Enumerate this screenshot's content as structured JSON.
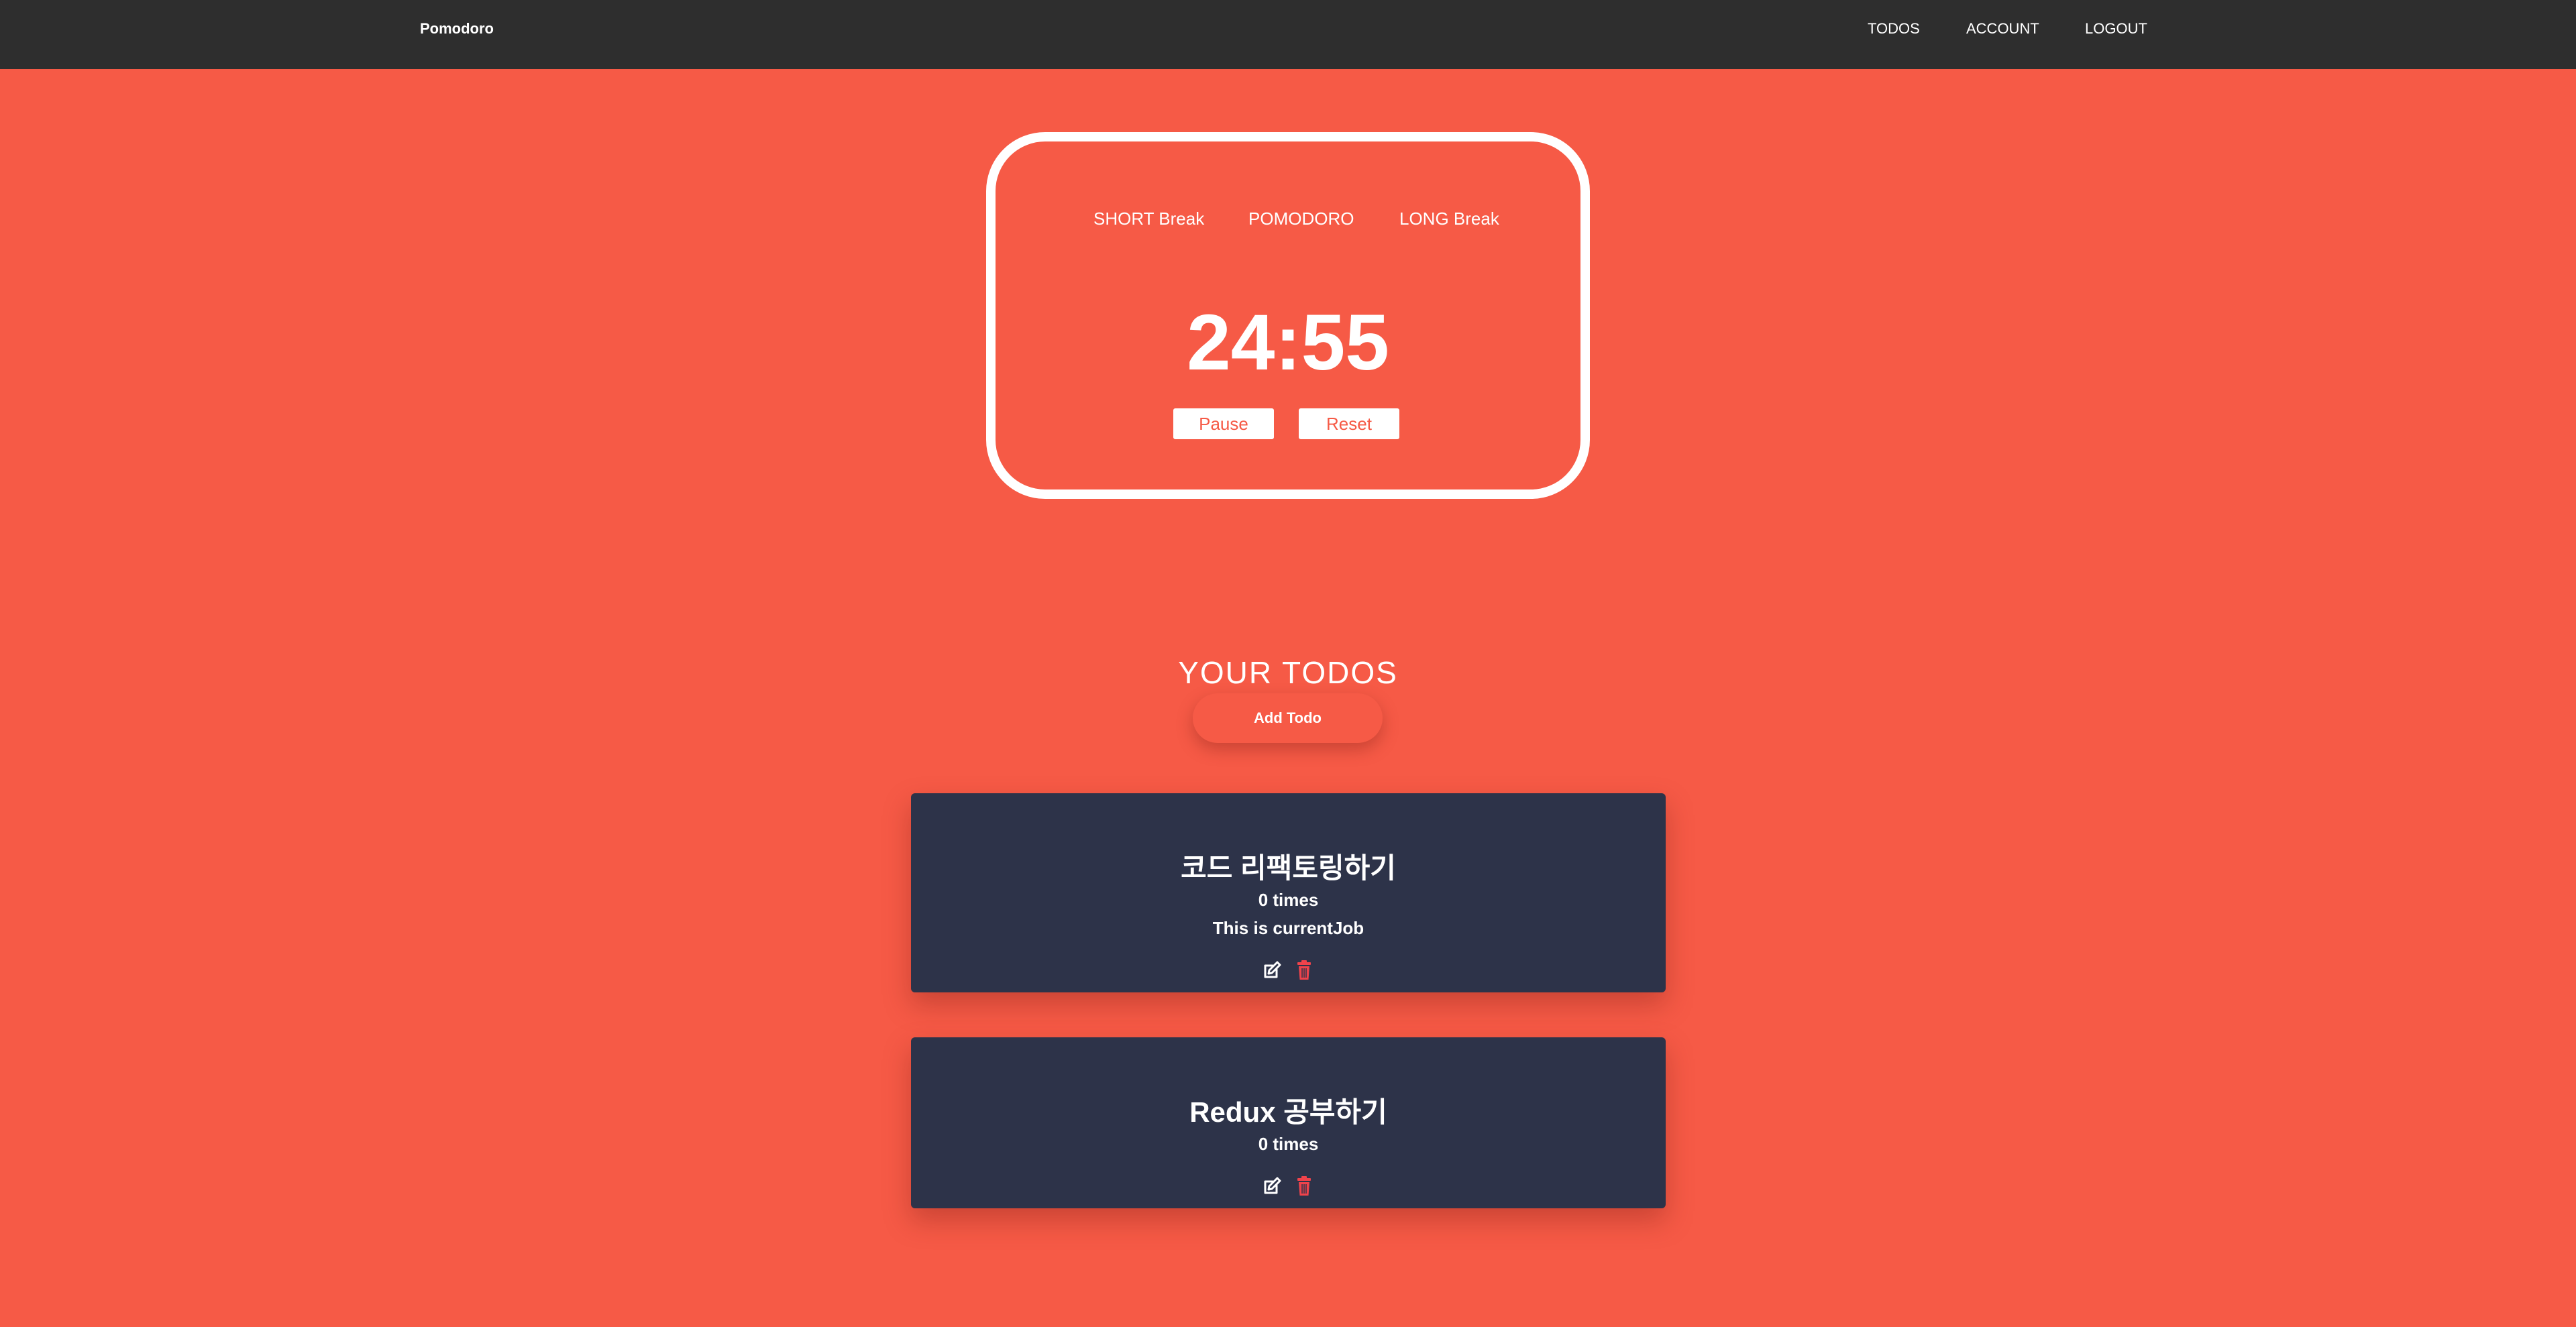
{
  "navbar": {
    "brand": "Pomodoro",
    "links": [
      {
        "label": "TODOS"
      },
      {
        "label": "ACCOUNT"
      },
      {
        "label": "LOGOUT"
      }
    ]
  },
  "timer": {
    "modes": [
      {
        "label": "SHORT Break"
      },
      {
        "label": "POMODORO"
      },
      {
        "label": "LONG Break"
      }
    ],
    "time": "24:55",
    "pause_label": "Pause",
    "reset_label": "Reset"
  },
  "todos": {
    "heading": "YOUR TODOS",
    "add_label": "Add Todo",
    "items": [
      {
        "title": "코드 리팩토링하기",
        "count": "0 times",
        "current": "This is currentJob",
        "icons": [
          "edit-icon",
          "trash-icon"
        ]
      },
      {
        "title": "Redux 공부하기",
        "count": "0 times",
        "icons": [
          "edit-icon",
          "trash-icon"
        ]
      }
    ]
  },
  "colors": {
    "background": "#f65a46",
    "navbar": "#2e2e2e",
    "card": "#2d3349",
    "trash": "#f0434b",
    "white": "#ffffff"
  }
}
